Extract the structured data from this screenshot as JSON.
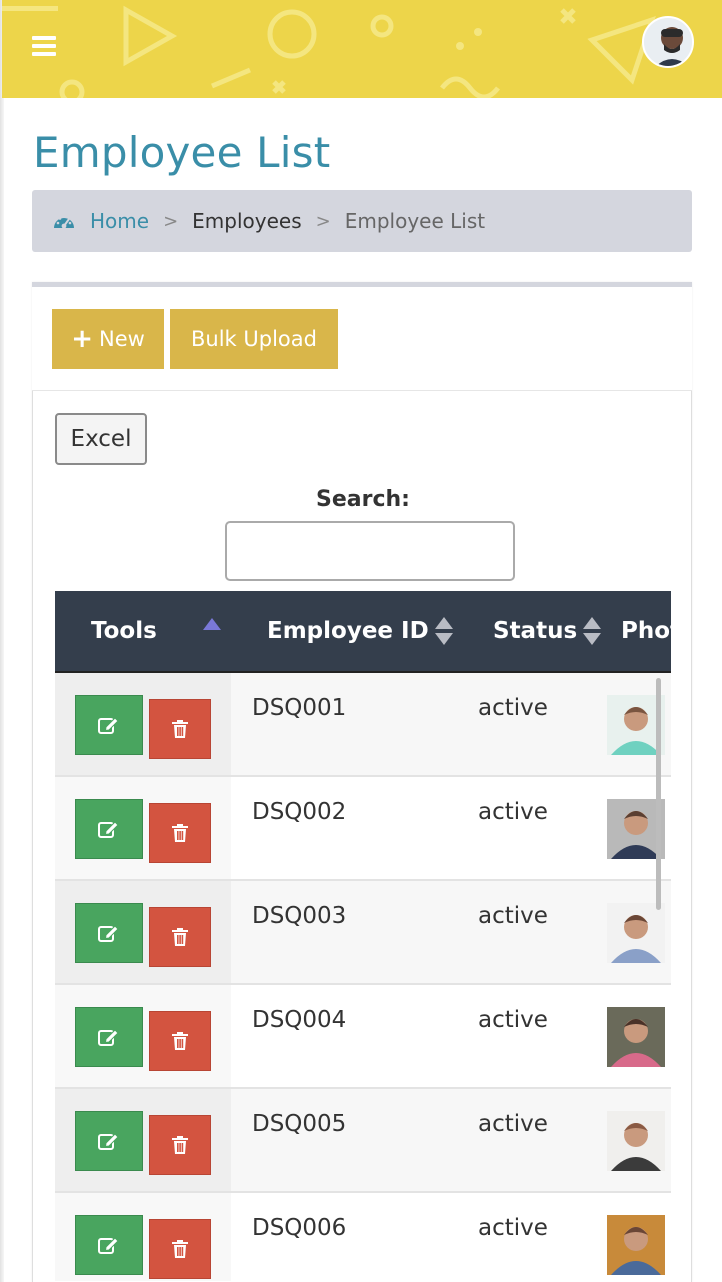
{
  "header": {
    "menu_icon": "hamburger-icon",
    "avatar_icon": "user-avatar"
  },
  "page": {
    "title": "Employee List"
  },
  "breadcrumb": {
    "icon": "dashboard-icon",
    "home": "Home",
    "separator": ">",
    "section": "Employees",
    "current": "Employee List"
  },
  "toolbar": {
    "new_label": "New",
    "bulk_upload_label": "Bulk Upload",
    "excel_label": "Excel",
    "search_label": "Search:",
    "search_value": ""
  },
  "table": {
    "columns": {
      "tools": "Tools",
      "employee_id": "Employee ID",
      "status": "Status",
      "photo": "Photo"
    },
    "rows": [
      {
        "id": "DSQ001",
        "status": "active"
      },
      {
        "id": "DSQ002",
        "status": "active"
      },
      {
        "id": "DSQ003",
        "status": "active"
      },
      {
        "id": "DSQ004",
        "status": "active"
      },
      {
        "id": "DSQ005",
        "status": "active"
      },
      {
        "id": "DSQ006",
        "status": "active"
      }
    ]
  },
  "colors": {
    "header_bg": "#edd54a",
    "title": "#3a8ea8",
    "gold_button": "#d9b64a",
    "table_header": "#343e4c",
    "edit_button": "#49a55f",
    "delete_button": "#d35440"
  }
}
